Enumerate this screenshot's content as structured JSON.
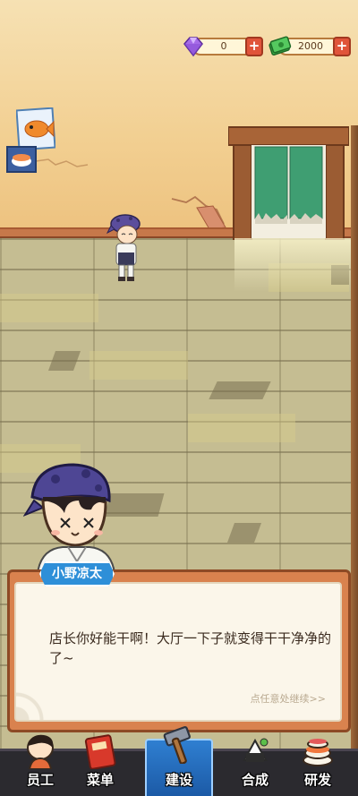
{
  "currencies": {
    "gems": {
      "value": "0",
      "icon": "purple-gem-icon",
      "plus": "+"
    },
    "cash": {
      "value": "2000",
      "icon": "green-cash-icon",
      "plus": "+"
    }
  },
  "dialog": {
    "speaker": "小野凉太",
    "text": "店长你好能干啊！大厅一下子就变得干干净净的了~",
    "continue_hint": "点任意处继续>>"
  },
  "nav": {
    "items": [
      {
        "label": "员工",
        "icon": "staff-icon"
      },
      {
        "label": "菜单",
        "icon": "menu-book-icon"
      },
      {
        "label": "建设",
        "icon": "hammer-icon",
        "active": true
      },
      {
        "label": "合成",
        "icon": "merge-sushi-icon"
      },
      {
        "label": "研发",
        "icon": "research-sushi-icon"
      }
    ]
  },
  "colors": {
    "accent_blue": "#2e8fd8",
    "plus_red": "#e0543a",
    "dialog_frame": "#d9824e"
  }
}
